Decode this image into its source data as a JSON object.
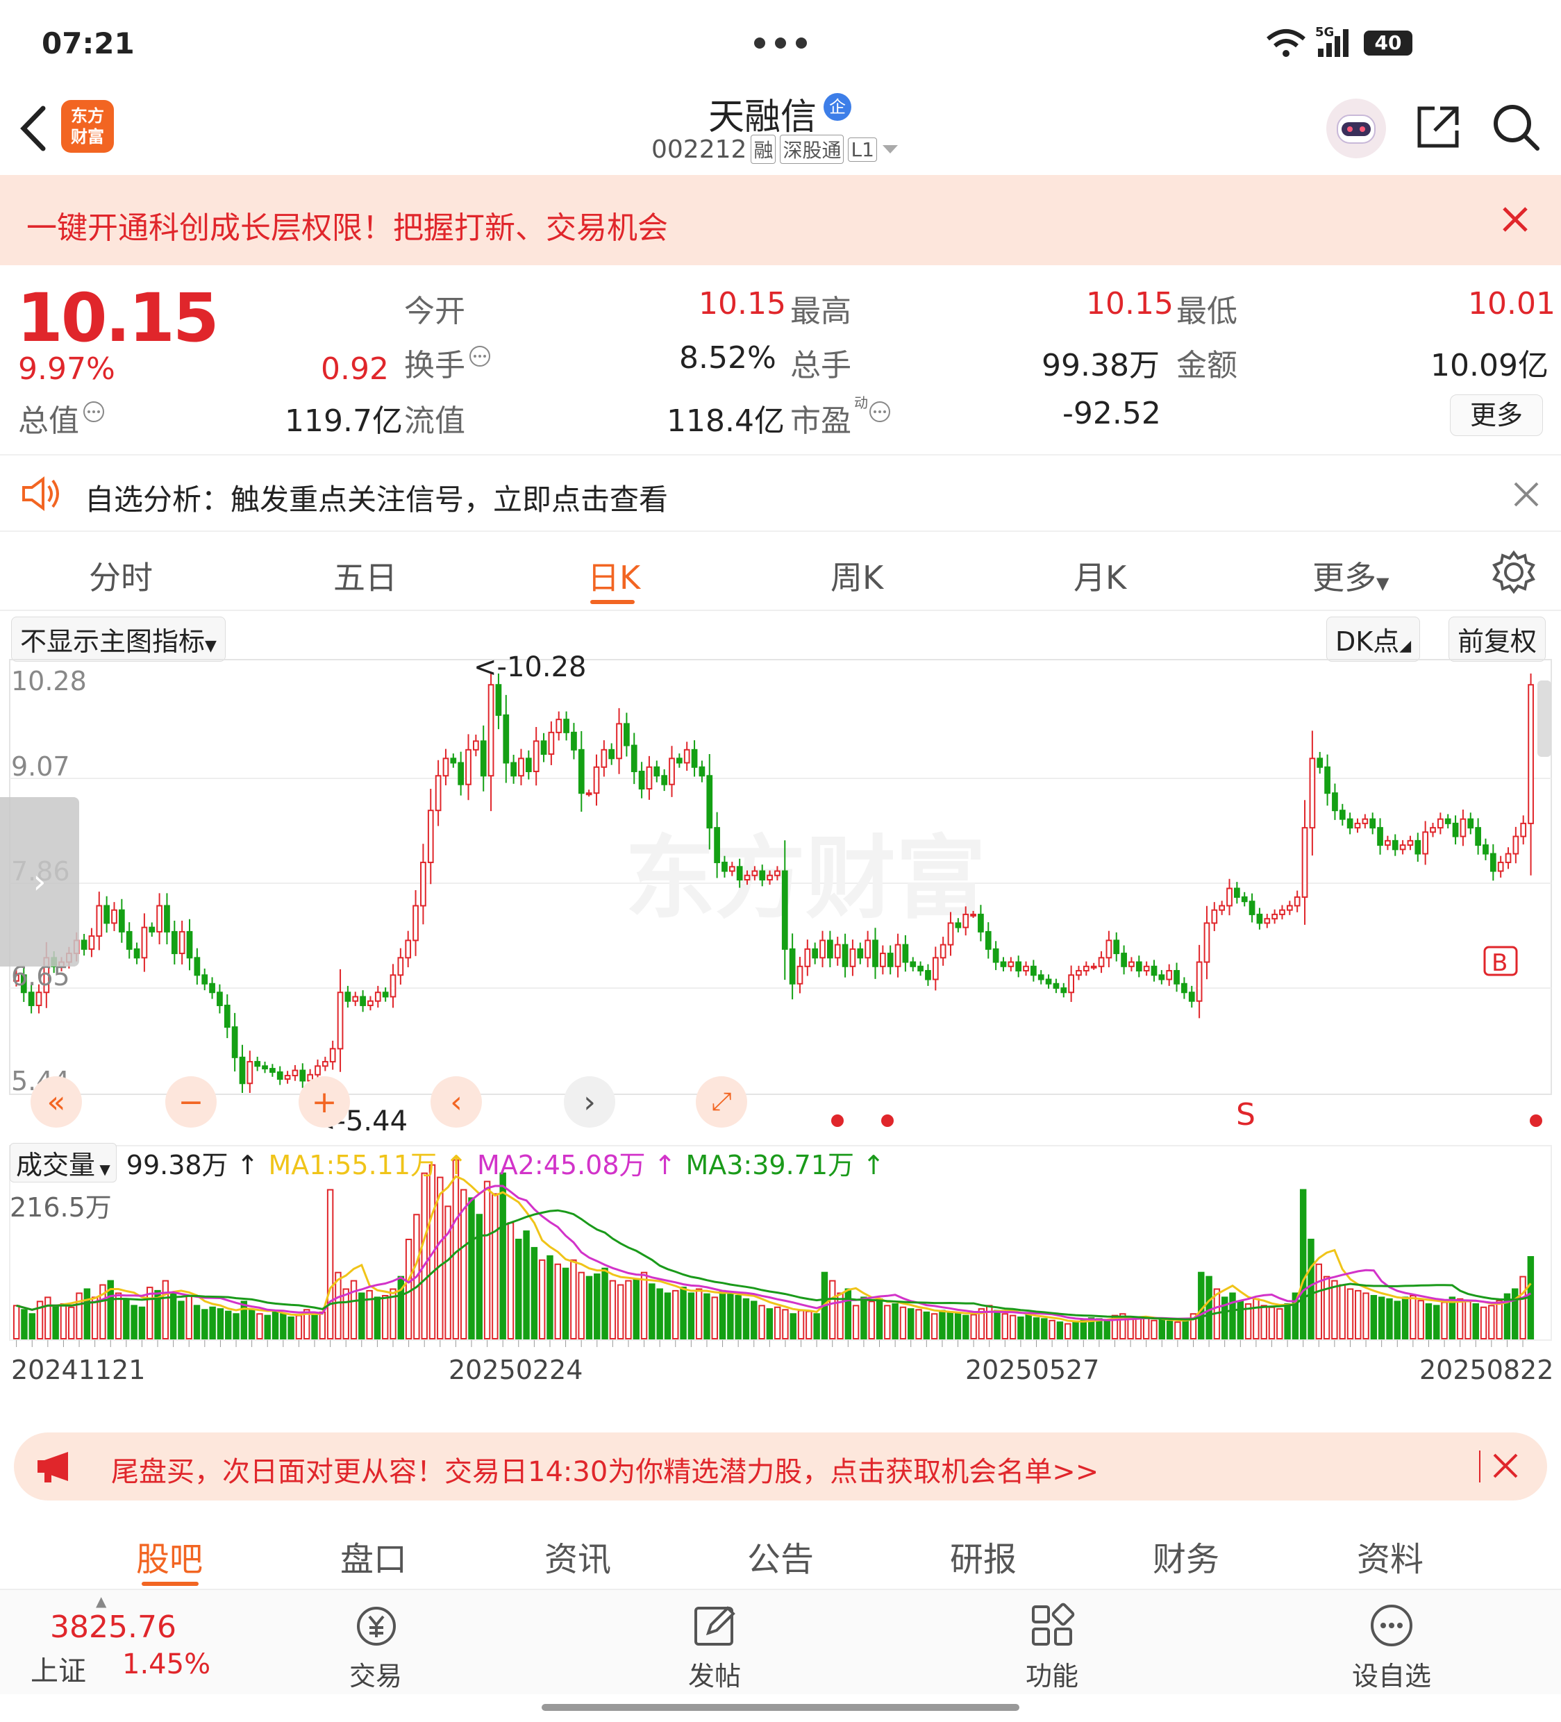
{
  "status": {
    "time": "07:21",
    "network": "5G",
    "battery": "40"
  },
  "header": {
    "app_logo": "东方\n财富",
    "title": "天融信",
    "verify_badge": "企",
    "code": "002212",
    "tags": [
      "融",
      "深股通",
      "L1"
    ]
  },
  "banner": {
    "text": "一键开通科创成长层权限！把握打新、交易机会"
  },
  "quote": {
    "price": "10.15",
    "change_pct": "9.97%",
    "change": "0.92",
    "open_label": "今开",
    "open": "10.15",
    "high_label": "最高",
    "high": "10.15",
    "low_label": "最低",
    "low": "10.01",
    "turnover_label": "换手",
    "turnover": "8.52%",
    "volume_label": "总手",
    "volume": "99.38万",
    "amount_label": "金额",
    "amount": "10.09亿",
    "mcap_label": "总值",
    "mcap": "119.7亿",
    "float_label": "流值",
    "float_cap": "118.4亿",
    "pe_label": "市盈",
    "pe_sup": "动",
    "pe": "-92.52",
    "more_label": "更多"
  },
  "alert": {
    "text": "自选分析：触发重点关注信号，立即点击查看"
  },
  "chart_tabs": {
    "t1": "分时",
    "t2": "五日",
    "t3": "日K",
    "t4": "周K",
    "t5": "月K",
    "t6": "更多"
  },
  "chart_toolbar": {
    "indicator": "不显示主图指标",
    "dk": "DK点",
    "adjust": "前复权"
  },
  "chart_data": {
    "type": "candlestick",
    "y_ticks": [
      "10.28",
      "9.07",
      "7.86",
      "6.65",
      "5.44"
    ],
    "ylim": [
      5.44,
      10.28
    ],
    "max_label": "<-10.28",
    "min_label": "<-5.44",
    "signal_s": "S",
    "signal_b": "B",
    "x_ticks": [
      "20241121",
      "20250224",
      "20250527",
      "20250822"
    ],
    "close": [
      6.8,
      6.6,
      6.45,
      6.6,
      7.0,
      6.9,
      6.95,
      7.05,
      7.2,
      7.1,
      7.25,
      7.6,
      7.4,
      7.55,
      7.3,
      7.1,
      7.0,
      7.35,
      7.3,
      7.6,
      7.3,
      7.05,
      7.3,
      7.0,
      6.8,
      6.7,
      6.6,
      6.45,
      6.2,
      5.85,
      5.55,
      5.8,
      5.75,
      5.72,
      5.68,
      5.6,
      5.64,
      5.7,
      5.58,
      5.65,
      5.75,
      5.8,
      5.95,
      6.6,
      6.5,
      6.55,
      6.45,
      6.5,
      6.6,
      6.55,
      6.8,
      7.0,
      7.2,
      7.6,
      8.1,
      8.7,
      9.1,
      9.3,
      9.25,
      9.0,
      9.4,
      9.5,
      9.1,
      10.15,
      9.8,
      9.25,
      9.1,
      9.3,
      9.15,
      9.5,
      9.35,
      9.6,
      9.75,
      9.6,
      9.4,
      8.9,
      8.9,
      9.2,
      9.4,
      9.3,
      9.7,
      9.45,
      9.15,
      8.95,
      9.2,
      9.1,
      9.0,
      9.3,
      9.25,
      9.4,
      9.2,
      9.1,
      8.5,
      8.1,
      8.0,
      8.05,
      7.9,
      7.95,
      8.0,
      7.9,
      7.95,
      8.0,
      7.1,
      6.7,
      6.9,
      7.1,
      7.0,
      7.2,
      7.0,
      7.15,
      6.9,
      7.1,
      7.0,
      7.2,
      6.9,
      7.05,
      6.9,
      7.15,
      6.95,
      6.9,
      6.85,
      6.75,
      7.0,
      7.15,
      7.4,
      7.35,
      7.5,
      7.5,
      7.3,
      7.1,
      6.95,
      6.9,
      6.95,
      6.85,
      6.9,
      6.8,
      6.75,
      6.7,
      6.65,
      6.6,
      6.8,
      6.85,
      6.9,
      6.9,
      7.0,
      7.2,
      7.05,
      6.9,
      6.95,
      6.85,
      6.9,
      6.8,
      6.75,
      6.85,
      6.7,
      6.6,
      6.5,
      6.95,
      7.4,
      7.55,
      7.6,
      7.8,
      7.7,
      7.65,
      7.5,
      7.4,
      7.45,
      7.5,
      7.55,
      7.6,
      7.7,
      8.5,
      9.3,
      9.2,
      8.9,
      8.7,
      8.6,
      8.5,
      8.55,
      8.6,
      8.5,
      8.3,
      8.35,
      8.25,
      8.3,
      8.35,
      8.2,
      8.45,
      8.5,
      8.6,
      8.55,
      8.4,
      8.6,
      8.5,
      8.3,
      8.2,
      8.0,
      8.1,
      8.2,
      8.4,
      8.55,
      10.15
    ],
    "volume_indicator": {
      "label": "成交量",
      "value": "99.38万",
      "ma1": "MA1:55.11万",
      "ma2": "MA2:45.08万",
      "ma3": "MA3:39.71万",
      "max_tick": "216.5万"
    },
    "volume": [
      40,
      35,
      30,
      45,
      50,
      40,
      42,
      38,
      55,
      60,
      50,
      65,
      70,
      55,
      48,
      40,
      38,
      62,
      58,
      70,
      55,
      45,
      52,
      40,
      35,
      38,
      36,
      33,
      30,
      45,
      35,
      30,
      28,
      32,
      30,
      26,
      28,
      35,
      30,
      32,
      180,
      80,
      60,
      70,
      55,
      58,
      50,
      52,
      60,
      75,
      120,
      150,
      200,
      210,
      195,
      160,
      216,
      180,
      170,
      150,
      190,
      175,
      200,
      140,
      120,
      130,
      110,
      95,
      100,
      90,
      85,
      95,
      80,
      75,
      78,
      85,
      70,
      65,
      70,
      72,
      80,
      66,
      60,
      55,
      58,
      62,
      55,
      60,
      54,
      50,
      58,
      56,
      52,
      48,
      45,
      40,
      36,
      38,
      35,
      30,
      34,
      33,
      30,
      80,
      70,
      55,
      60,
      40,
      50,
      45,
      48,
      40,
      42,
      38,
      36,
      35,
      32,
      30,
      34,
      32,
      30,
      28,
      29,
      36,
      40,
      34,
      30,
      28,
      26,
      30,
      25,
      24,
      22,
      20,
      18,
      21,
      23,
      25,
      24,
      22,
      28,
      30,
      26,
      24,
      25,
      22,
      23,
      21,
      20,
      24,
      30,
      80,
      75,
      60,
      50,
      55,
      45,
      42,
      48,
      40,
      38,
      36,
      42,
      55,
      180,
      120,
      90,
      75,
      70,
      65,
      60,
      58,
      55,
      52,
      50,
      48,
      45,
      50,
      52,
      46,
      42,
      40,
      44,
      50,
      48,
      45,
      42,
      38,
      40,
      46,
      54,
      60,
      75,
      99
    ]
  },
  "promo": {
    "text": "尾盘买，次日面对更从容！交易日14:30为你精选潜力股，点击获取机会名单>>"
  },
  "bottom_tabs": {
    "b1": "股吧",
    "b2": "盘口",
    "b3": "资讯",
    "b4": "公告",
    "b5": "研报",
    "b6": "财务",
    "b7": "资料"
  },
  "bottom_bar": {
    "index_value": "3825.76",
    "index_name": "上证",
    "index_pct": "1.45%",
    "trade": "交易",
    "post": "发帖",
    "func": "功能",
    "watch": "设自选"
  },
  "colors": {
    "up": "#e0262b",
    "down": "#14a014",
    "accent": "#f26522",
    "ma1": "#f0c419",
    "ma2": "#d233c9",
    "ma3": "#1a9a1a"
  }
}
